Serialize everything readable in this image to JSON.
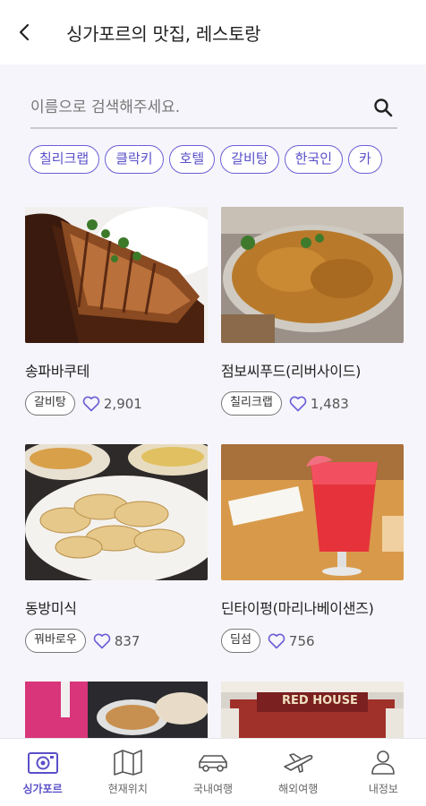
{
  "header": {
    "title": "싱가포르의 맛집, 레스토랑"
  },
  "search": {
    "placeholder": "이름으로 검색해주세요."
  },
  "chips": [
    "칠리크랩",
    "클락키",
    "호텔",
    "갈비탕",
    "한국인",
    "카"
  ],
  "cards": [
    {
      "name": "송파바쿠테",
      "tag": "갈비탕",
      "likes": "2,901"
    },
    {
      "name": "점보씨푸드(리버사이드)",
      "tag": "칠리크랩",
      "likes": "1,483"
    },
    {
      "name": "동방미식",
      "tag": "꿔바로우",
      "likes": "837"
    },
    {
      "name": "딘타이펑(마리나베이샌즈)",
      "tag": "딤섬",
      "likes": "756"
    }
  ],
  "partial_card": {
    "sign_text": "RED HOUSE"
  },
  "nav": [
    {
      "label": "싱가포르",
      "icon": "camera-icon",
      "active": true
    },
    {
      "label": "현재위치",
      "icon": "map-icon",
      "active": false
    },
    {
      "label": "국내여행",
      "icon": "car-icon",
      "active": false
    },
    {
      "label": "해외여행",
      "icon": "airplane-icon",
      "active": false
    },
    {
      "label": "내정보",
      "icon": "person-icon",
      "active": false
    }
  ],
  "colors": {
    "accent": "#5a4fc9",
    "background": "#f6f5fb"
  }
}
